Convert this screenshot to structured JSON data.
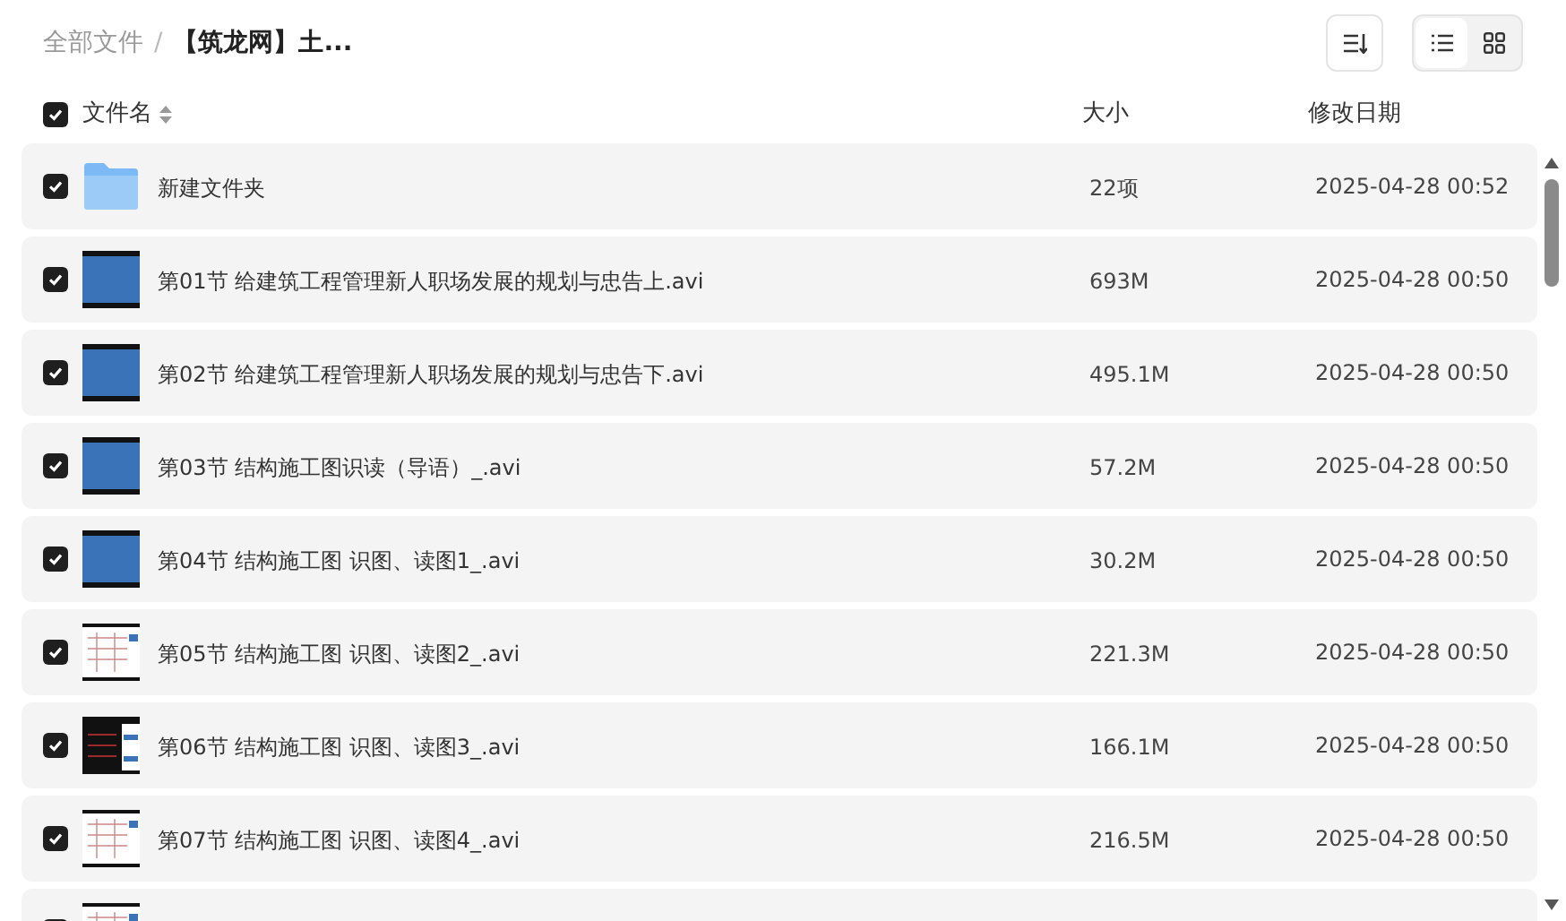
{
  "breadcrumb": [
    {
      "label": "全部文件",
      "current": false
    },
    {
      "label": "【筑龙网】土...",
      "current": true
    }
  ],
  "separator": "/",
  "view_modes": [
    {
      "kind": "list",
      "selected": true
    },
    {
      "kind": "grid",
      "selected": false
    }
  ],
  "select_all": {
    "checked": true
  },
  "columns": [
    {
      "label": "文件名",
      "sortable": true
    },
    {
      "label": "大小",
      "sortable": false
    },
    {
      "label": "修改日期",
      "sortable": false
    }
  ],
  "rows": [
    {
      "kind": "folder",
      "checked": true,
      "name": "新建文件夹",
      "size": "22项",
      "date": "2025-04-28 00:52"
    },
    {
      "kind": "lecture",
      "checked": true,
      "name": "第01节 给建筑工程管理新人职场发展的规划与忠告上.avi",
      "size": "693M",
      "date": "2025-04-28 00:50"
    },
    {
      "kind": "lecture",
      "checked": true,
      "name": "第02节 给建筑工程管理新人职场发展的规划与忠告下.avi",
      "size": "495.1M",
      "date": "2025-04-28 00:50"
    },
    {
      "kind": "lecture",
      "checked": true,
      "name": "第03节 结构施工图识读（导语）_.avi",
      "size": "57.2M",
      "date": "2025-04-28 00:50"
    },
    {
      "kind": "lecture",
      "checked": true,
      "name": "第04节 结构施工图 识图、读图1_.avi",
      "size": "30.2M",
      "date": "2025-04-28 00:50"
    },
    {
      "kind": "blueprint",
      "checked": true,
      "name": "第05节 结构施工图 识图、读图2_.avi",
      "size": "221.3M",
      "date": "2025-04-28 00:50"
    },
    {
      "kind": "screen",
      "checked": true,
      "name": "第06节 结构施工图 识图、读图3_.avi",
      "size": "166.1M",
      "date": "2025-04-28 00:50"
    },
    {
      "kind": "blueprint",
      "checked": true,
      "name": "第07节 结构施工图 识图、读图4_.avi",
      "size": "216.5M",
      "date": "2025-04-28 00:50"
    },
    {
      "kind": "blueprint",
      "checked": true
    }
  ]
}
